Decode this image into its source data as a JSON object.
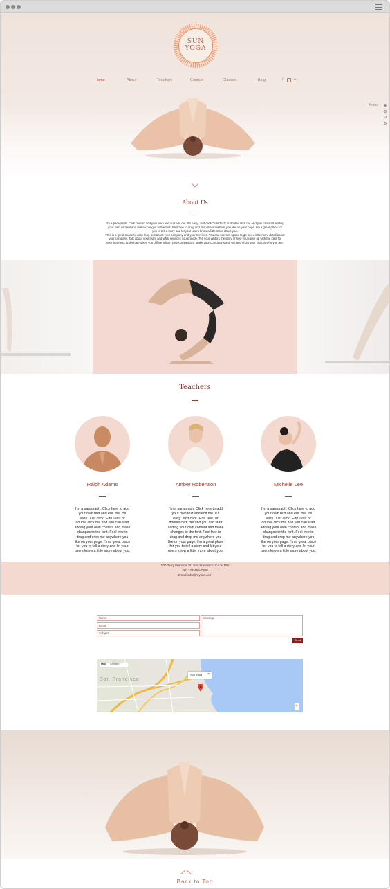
{
  "logo": {
    "line1": "SUN",
    "line2": "YOGA"
  },
  "nav": {
    "items": [
      {
        "label": "Home"
      },
      {
        "label": "About"
      },
      {
        "label": "Teachers"
      },
      {
        "label": "Contact"
      },
      {
        "label": "Classes"
      },
      {
        "label": "Blog"
      }
    ],
    "social": [
      "f",
      "ig",
      "t"
    ]
  },
  "side_nav": {
    "label": "Home"
  },
  "about": {
    "title": "About Us",
    "lines": [
      "I'm a paragraph. Click here to add your own text and edit me. It's easy. Just click \"Edit Text\" or double click me and you can start adding",
      "your own content and make changes to the font. Feel free to drag and drop me anywhere you like on your page. I'm a great place for",
      "you to tell a story and let your users know a little more about you.",
      "This is a great space to write long text about your company and your services. You can use this space to go into a little more detail about",
      "your company. Talk about your team and what services you provide. Tell your visitors the story of how you came up with the idea for",
      "your business and what makes you different from your competitors. Make your company stand out and show your visitors who you are."
    ]
  },
  "teachers": {
    "title": "Teachers",
    "list": [
      {
        "name": "Ralph Adams",
        "bio": "I'm a paragraph. Click here to add your own text and edit me. It's easy. Just click \"Edit Text\" or double click me and you can start adding your own content and make changes to the font. Feel free to drag and drop me anywhere you like on your page. I'm a great place for you to tell a story and let your users know a little more about you."
      },
      {
        "name": "Amber Robertson",
        "bio": "I'm a paragraph. Click here to add your own text and edit me. It's easy. Just click \"Edit Text\" or double click me and you can start adding your own content and make changes to the font. Feel free to drag and drop me anywhere you like on your page. I'm a great place for you to tell a story and let your users know a little more about you."
      },
      {
        "name": "Michelle Lee",
        "bio": "I'm a paragraph. Click here to add your own text and edit me. It's easy. Just click \"Edit Text\" or double click me and you can start adding your own content and make changes to the font. Feel free to drag and drop me anywhere you like on your page. I'm a great place for you to tell a story and let your users know a little more about you."
      }
    ]
  },
  "contact": {
    "address": "500 Terry Francois St. San Francisco, CA 94158",
    "tel": "Tel: 123-456-7890",
    "email": "Email: info@mysite.com"
  },
  "form": {
    "name": "Name",
    "email": "Email",
    "subject": "Subject",
    "message": "Message",
    "send": "Send"
  },
  "map": {
    "tab_map": "Map",
    "tab_sat": "Satellite",
    "city": "San Francisco",
    "pin_label": "Sun Yoga",
    "pin_close": "×"
  },
  "footer": {
    "back_to_top": "Back to Top"
  },
  "colors": {
    "accent": "#8b2d23",
    "blush": "#f4d9d1",
    "logo": "#f0a07a"
  }
}
